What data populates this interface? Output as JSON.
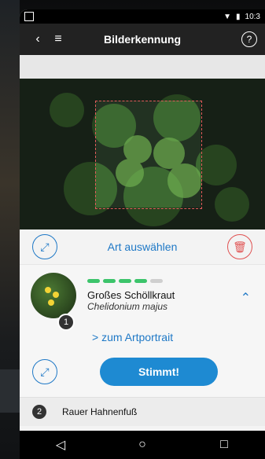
{
  "status": {
    "time": "10:3"
  },
  "appbar": {
    "title": "Bilderkennung",
    "help": "?"
  },
  "actions": {
    "choose_species": "Art auswählen"
  },
  "result": {
    "rank": "1",
    "common": "Großes Schöllkraut",
    "latin": "Chelidonium majus",
    "confidence_bars_on": 4,
    "confidence_bars_total": 5,
    "portrait_link": "> zum Artportrait",
    "confirm": "Stimmt!"
  },
  "next_result": {
    "rank": "2",
    "name": "Rauer Hahnenfuß"
  },
  "icons": {
    "back": "chevron-left-icon",
    "menu": "hamburger-icon",
    "expand": "expand-icon",
    "trash": "trash-icon",
    "collapse": "chevron-up-icon"
  },
  "colors": {
    "primary": "#1e78c6",
    "danger": "#e05151",
    "bar_on": "#3cc46b"
  }
}
